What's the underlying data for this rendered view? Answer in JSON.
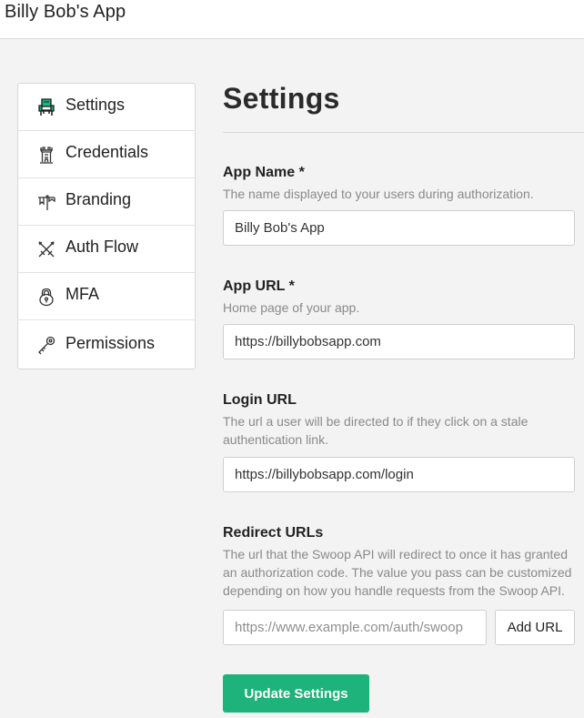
{
  "header": {
    "app_title": "Billy Bob's App"
  },
  "sidebar": {
    "items": [
      {
        "label": "Settings",
        "icon": "throne-icon",
        "active": true
      },
      {
        "label": "Credentials",
        "icon": "tower-icon"
      },
      {
        "label": "Branding",
        "icon": "banner-icon"
      },
      {
        "label": "Auth Flow",
        "icon": "crossed-swords-icon"
      },
      {
        "label": "MFA",
        "icon": "padlock-icon"
      },
      {
        "label": "Permissions",
        "icon": "key-icon"
      }
    ]
  },
  "main": {
    "title": "Settings",
    "fields": {
      "app_name": {
        "label": "App Name *",
        "help": "The name displayed to your users during authorization.",
        "value": "Billy Bob's App"
      },
      "app_url": {
        "label": "App URL *",
        "help": "Home page of your app.",
        "value": "https://billybobsapp.com"
      },
      "login_url": {
        "label": "Login URL",
        "help": "The url a user will be directed to if they click on a stale authentication link.",
        "value": "https://billybobsapp.com/login"
      },
      "redirect_urls": {
        "label": "Redirect URLs",
        "help": "The url that the Swoop API will redirect to once it has granted an authorization code. The value you pass can be customized depending on how you handle requests from the Swoop API.",
        "placeholder": "https://www.example.com/auth/swoop",
        "add_button": "Add URL"
      }
    },
    "submit_label": "Update Settings"
  },
  "colors": {
    "accent": "#1eb37b",
    "active_icon": "#1eb37b",
    "help_text": "#8a8a8a",
    "background": "#f3f3f3"
  }
}
